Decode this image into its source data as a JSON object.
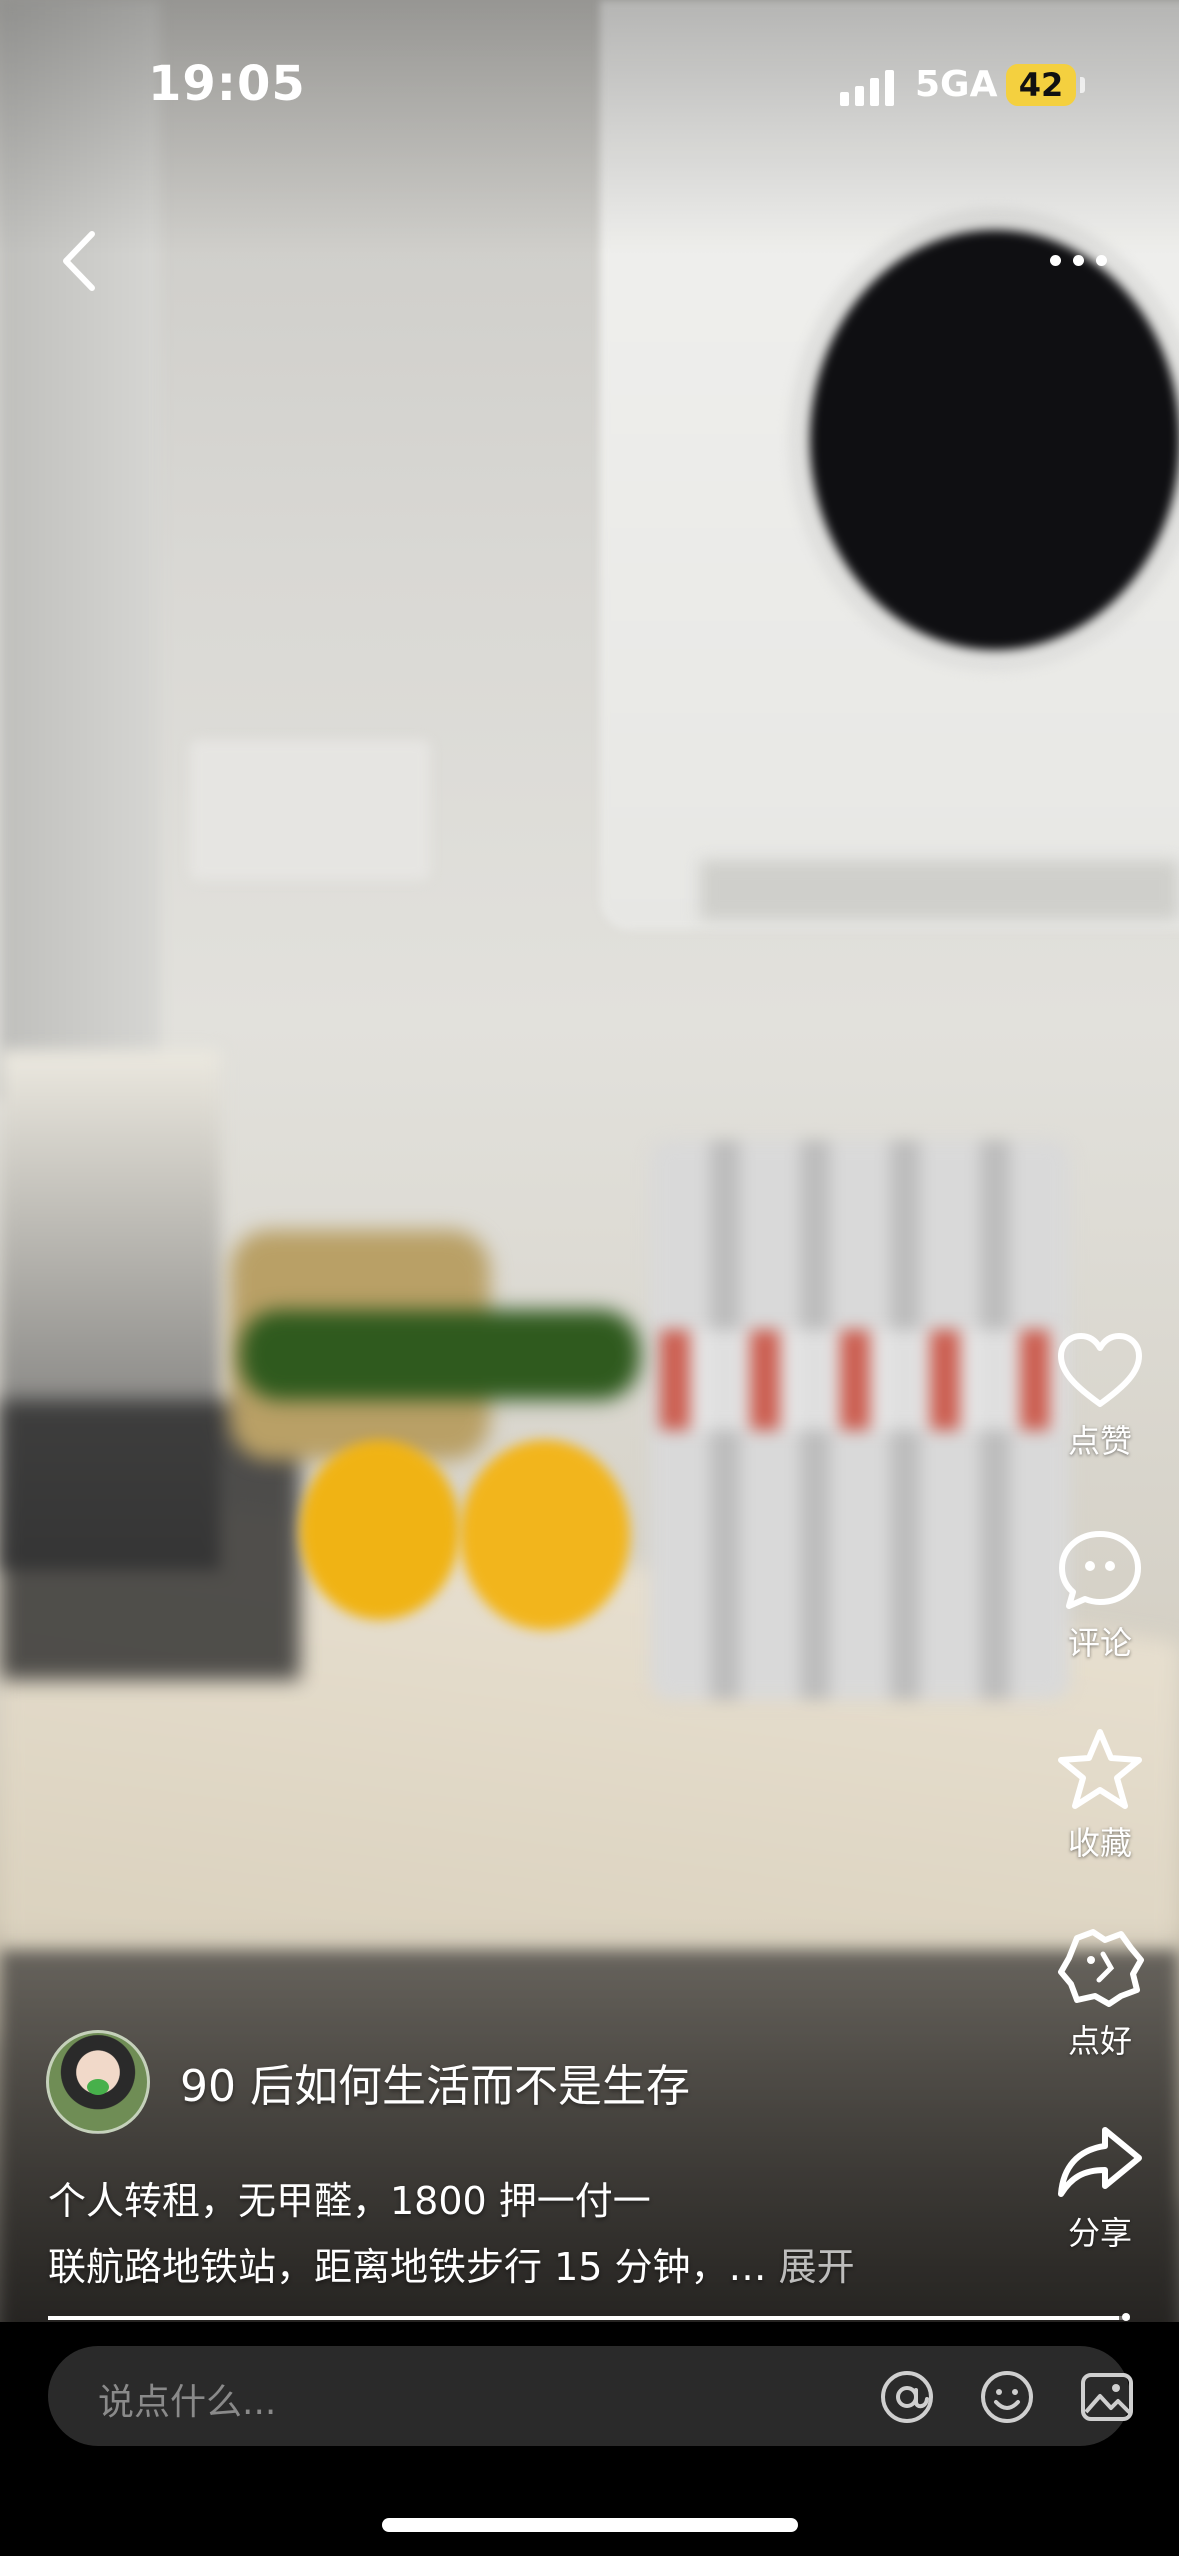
{
  "status_bar": {
    "time": "19:05",
    "network": "5GA",
    "battery": "42",
    "battery_color": "#f4d03f"
  },
  "nav": {
    "back_icon": "chevron-left-icon",
    "more_icon": "more-dots-icon"
  },
  "actions": [
    {
      "name": "like",
      "label": "点赞",
      "icon": "heart-icon"
    },
    {
      "name": "comment",
      "label": "评论",
      "icon": "chat-bubble-icon"
    },
    {
      "name": "favorite",
      "label": "收藏",
      "icon": "star-icon"
    },
    {
      "name": "nice",
      "label": "点好",
      "icon": "badge-smile-icon"
    },
    {
      "name": "share",
      "label": "分享",
      "icon": "share-arrow-icon"
    }
  ],
  "post": {
    "author_name": "90 后如何生活而不是生存",
    "caption_line1": "个人转租，无甲醛，1800 押一付一",
    "caption_line2": "联航路地铁站，距离地铁步行 15 分钟，…",
    "expand_label": "展开",
    "progress": 0.99
  },
  "comment_bar": {
    "placeholder": "说点什么...",
    "icons": [
      "at-icon",
      "emoji-icon",
      "image-icon"
    ]
  }
}
